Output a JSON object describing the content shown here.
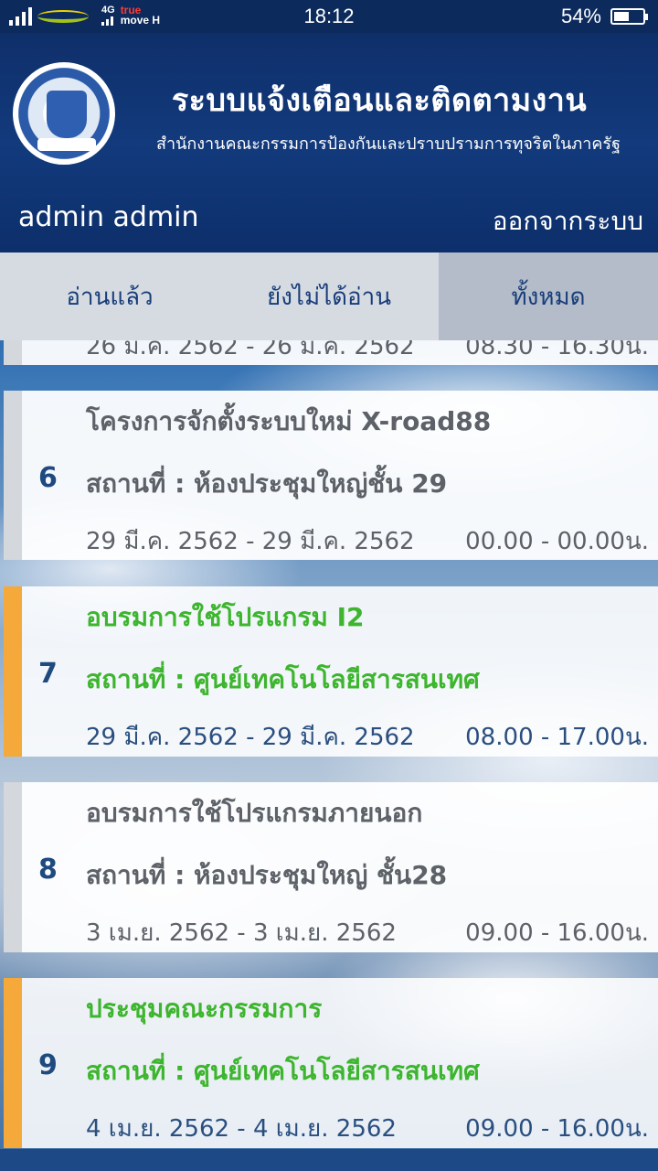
{
  "status_bar": {
    "network": "4G",
    "carrier_line1": "true",
    "carrier_line2": "move",
    "carrier_h": "H",
    "time": "18:12",
    "battery": "54%",
    "battery_level": 0.54
  },
  "header": {
    "title": "ระบบแจ้งเตือนและติดตามงาน",
    "subtitle": "สำนักงานคณะกรรมการป้องกันและปราบปรามการทุจริตในภาครัฐ",
    "user": "admin admin",
    "logout": "ออกจากระบบ"
  },
  "tabs": [
    {
      "label": "อ่านแล้ว"
    },
    {
      "label": "ยังไม่ได้อ่าน"
    },
    {
      "label": "ทั้งหมด",
      "active": true
    }
  ],
  "partial_item": {
    "date": "26 ม.ค. 2562 - 26 ม.ค. 2562",
    "time": "08.30 - 16.30น."
  },
  "items": [
    {
      "num": "6",
      "title": "โครงการจักตั้งระบบใหม่ X-road88",
      "location": "สถานที่ : ห้องประชุมใหญ่ชั้น 29",
      "date": "29 มี.ค. 2562 - 29 มี.ค. 2562",
      "time": "00.00 - 00.00น.",
      "highlight": false
    },
    {
      "num": "7",
      "title": "อบรมการใช้โปรแกรม I2",
      "location": "สถานที่ : ศูนย์เทคโนโลยีสารสนเทศ",
      "date": "29 มี.ค. 2562 - 29 มี.ค. 2562",
      "time": "08.00 - 17.00น.",
      "highlight": true
    },
    {
      "num": "8",
      "title": "อบรมการใช้โปรแกรมภายนอก",
      "location": "สถานที่ : ห้องประชุมใหญ่ ชั้น28",
      "date": "3 เม.ย. 2562 - 3 เม.ย. 2562",
      "time": "09.00 - 16.00น.",
      "highlight": false
    },
    {
      "num": "9",
      "title": "ประชุมคณะกรรมการ",
      "location": "สถานที่ : ศูนย์เทคโนโลยีสารสนเทศ",
      "date": "4 เม.ย. 2562 - 4 เม.ย. 2562",
      "time": "09.00 - 16.00น.",
      "highlight": true
    }
  ],
  "colors": {
    "header_bg": "#0f2f6a",
    "accent_unread": "#f6a93b",
    "title_unread": "#3db52e",
    "text_dark": "#5d6168",
    "num_color": "#1f4a80"
  }
}
